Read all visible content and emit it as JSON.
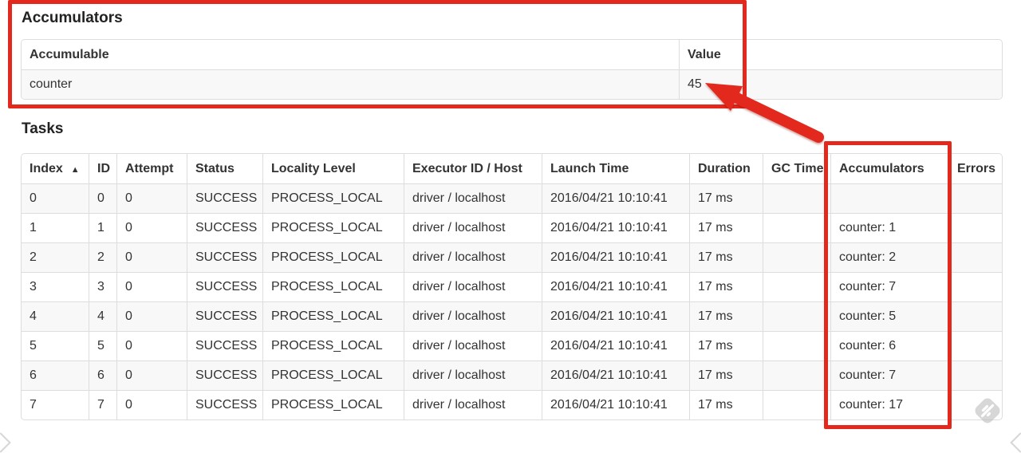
{
  "accumulators_section": {
    "heading": "Accumulators",
    "table": {
      "columns": [
        "Accumulable",
        "Value"
      ],
      "rows": [
        {
          "accumulable": "counter",
          "value": "45"
        }
      ]
    }
  },
  "tasks_section": {
    "heading": "Tasks",
    "table": {
      "columns": {
        "index": "Index",
        "id": "ID",
        "attempt": "Attempt",
        "status": "Status",
        "locality": "Locality Level",
        "executor": "Executor ID / Host",
        "launch": "Launch Time",
        "duration": "Duration",
        "gc_time": "GC Time",
        "accumulators": "Accumulators",
        "errors": "Errors"
      },
      "sort": {
        "column": "Index",
        "direction_icon": "▲"
      },
      "rows": [
        {
          "index": "0",
          "id": "0",
          "attempt": "0",
          "status": "SUCCESS",
          "locality": "PROCESS_LOCAL",
          "executor": "driver / localhost",
          "launch": "2016/04/21 10:10:41",
          "duration": "17 ms",
          "gc_time": "",
          "accumulators": "",
          "errors": ""
        },
        {
          "index": "1",
          "id": "1",
          "attempt": "0",
          "status": "SUCCESS",
          "locality": "PROCESS_LOCAL",
          "executor": "driver / localhost",
          "launch": "2016/04/21 10:10:41",
          "duration": "17 ms",
          "gc_time": "",
          "accumulators": "counter: 1",
          "errors": ""
        },
        {
          "index": "2",
          "id": "2",
          "attempt": "0",
          "status": "SUCCESS",
          "locality": "PROCESS_LOCAL",
          "executor": "driver / localhost",
          "launch": "2016/04/21 10:10:41",
          "duration": "17 ms",
          "gc_time": "",
          "accumulators": "counter: 2",
          "errors": ""
        },
        {
          "index": "3",
          "id": "3",
          "attempt": "0",
          "status": "SUCCESS",
          "locality": "PROCESS_LOCAL",
          "executor": "driver / localhost",
          "launch": "2016/04/21 10:10:41",
          "duration": "17 ms",
          "gc_time": "",
          "accumulators": "counter: 7",
          "errors": ""
        },
        {
          "index": "4",
          "id": "4",
          "attempt": "0",
          "status": "SUCCESS",
          "locality": "PROCESS_LOCAL",
          "executor": "driver / localhost",
          "launch": "2016/04/21 10:10:41",
          "duration": "17 ms",
          "gc_time": "",
          "accumulators": "counter: 5",
          "errors": ""
        },
        {
          "index": "5",
          "id": "5",
          "attempt": "0",
          "status": "SUCCESS",
          "locality": "PROCESS_LOCAL",
          "executor": "driver / localhost",
          "launch": "2016/04/21 10:10:41",
          "duration": "17 ms",
          "gc_time": "",
          "accumulators": "counter: 6",
          "errors": ""
        },
        {
          "index": "6",
          "id": "6",
          "attempt": "0",
          "status": "SUCCESS",
          "locality": "PROCESS_LOCAL",
          "executor": "driver / localhost",
          "launch": "2016/04/21 10:10:41",
          "duration": "17 ms",
          "gc_time": "",
          "accumulators": "counter: 7",
          "errors": ""
        },
        {
          "index": "7",
          "id": "7",
          "attempt": "0",
          "status": "SUCCESS",
          "locality": "PROCESS_LOCAL",
          "executor": "driver / localhost",
          "launch": "2016/04/21 10:10:41",
          "duration": "17 ms",
          "gc_time": "",
          "accumulators": "counter: 17",
          "errors": ""
        }
      ]
    }
  },
  "annotations": {
    "color": "#e3291d",
    "items": [
      "box-around-accumulators-section",
      "box-around-accumulators-column",
      "arrow-pointing-to-value-45"
    ]
  },
  "watermark": {
    "icon": "annotation-app-stamp-icon",
    "color": "#c6c6c6"
  }
}
